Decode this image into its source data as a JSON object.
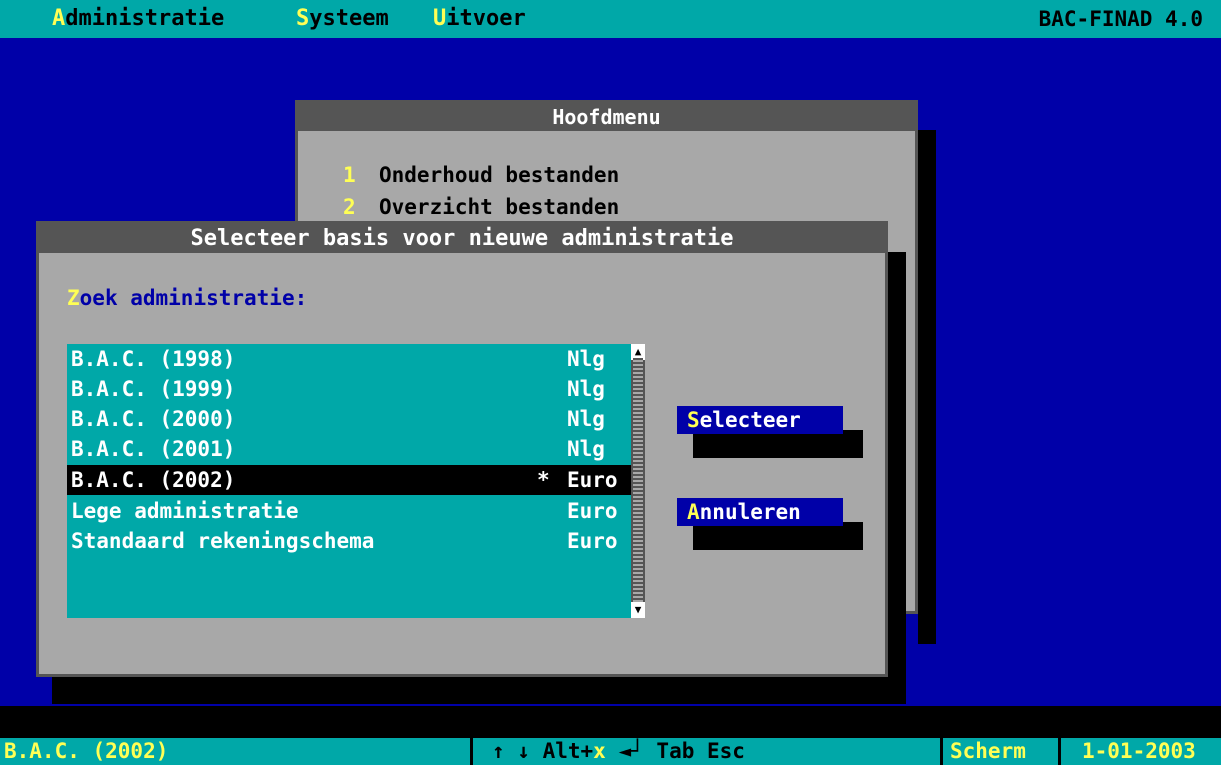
{
  "menubar": {
    "items": [
      {
        "hotkey": "A",
        "rest": "dministratie"
      },
      {
        "hotkey": "S",
        "rest": "ysteem"
      },
      {
        "hotkey": "U",
        "rest": "itvoer"
      }
    ],
    "app_title": "BAC-FINAD 4.0"
  },
  "hoofdmenu": {
    "title": "Hoofdmenu",
    "items": [
      {
        "num": "1",
        "label": "Onderhoud bestanden"
      },
      {
        "num": "2",
        "label": "Overzicht bestanden"
      }
    ]
  },
  "dialog": {
    "title": "Selecteer basis voor nieuwe administratie",
    "search_label_hotkey": "Z",
    "search_label_rest": "oek administratie:",
    "list": [
      {
        "name": "B.A.C. (1998)",
        "mark": "",
        "currency": "Nlg",
        "selected": false
      },
      {
        "name": "B.A.C. (1999)",
        "mark": "",
        "currency": "Nlg",
        "selected": false
      },
      {
        "name": "B.A.C. (2000)",
        "mark": "",
        "currency": "Nlg",
        "selected": false
      },
      {
        "name": "B.A.C. (2001)",
        "mark": "",
        "currency": "Nlg",
        "selected": false
      },
      {
        "name": "B.A.C. (2002)",
        "mark": "*",
        "currency": "Euro",
        "selected": true
      },
      {
        "name": "Lege administratie",
        "mark": "",
        "currency": "Euro",
        "selected": false
      },
      {
        "name": "Standaard rekeningschema",
        "mark": "",
        "currency": "Euro",
        "selected": false
      }
    ],
    "buttons": {
      "select_hotkey": "S",
      "select_rest": "electeer",
      "cancel_hotkey": "A",
      "cancel_rest": "nnuleren"
    }
  },
  "statusbar": {
    "current_admin": "B.A.C. (2002)",
    "keys_arrows": "↑ ↓ Alt+",
    "keys_x": "x",
    "keys_enter": "◄┘",
    "keys_rest": "Tab Esc",
    "screen_label": "Scherm",
    "date": "1-01-2003"
  },
  "colors": {
    "desktop": "#0000a8",
    "cyan": "#00a8a8",
    "gray": "#a8a8a8",
    "hotkey": "#ffff55"
  }
}
